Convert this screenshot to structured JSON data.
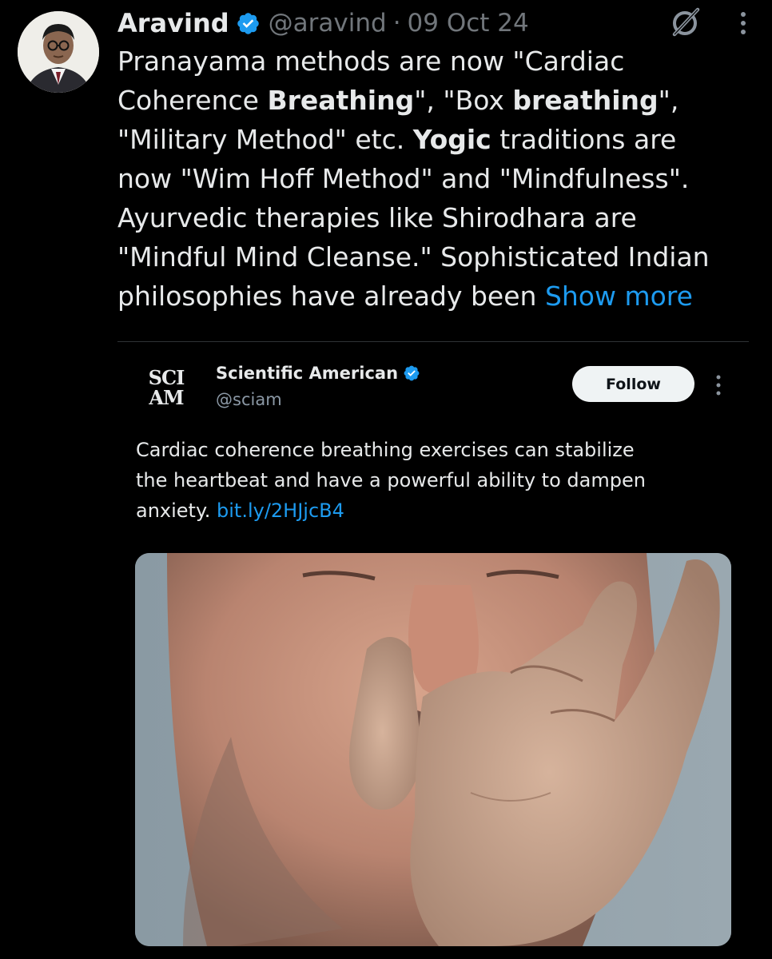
{
  "tweet": {
    "author_name": "Aravind",
    "handle": "@aravind",
    "separator": "·",
    "date": "09 Oct 24",
    "text_lines": [
      [
        "Pranayama methods are now \"Cardiac"
      ],
      [
        "Coherence ",
        "Breathing",
        "\", \"Box ",
        "breathing",
        "\","
      ],
      [
        "\"Military Method\" etc. ",
        "Yogic",
        " traditions are"
      ],
      [
        "now \"Wim Hoff Method\" and \"Mindfulness\"."
      ],
      [
        "Ayurvedic therapies like Shirodhara are"
      ],
      [
        "\"Mindful Mind Cleanse.\" Sophisticated Indian"
      ],
      [
        "philosophies have already been "
      ]
    ],
    "show_more_label": "Show more",
    "icons": [
      "verified-badge-icon",
      "grok-icon",
      "more-options-icon"
    ]
  },
  "quoted_tweet": {
    "logo_lines": [
      "SCI",
      "AM"
    ],
    "author_name": "Scientific American",
    "handle": "@sciam",
    "follow_label": "Follow",
    "text_lines": [
      "Cardiac coherence breathing exercises can stabilize",
      "the heartbeat and have a powerful ability to dampen",
      "anxiety. "
    ],
    "link_text": "bit.ly/2HJjcB4",
    "image_subject": "man performing alternate nostril breathing",
    "icons": [
      "verified-badge-icon",
      "more-options-icon"
    ]
  },
  "colors": {
    "background": "#000000",
    "text": "#e7e9ea",
    "secondary_text": "#71767b",
    "link": "#1d9bf0",
    "verified": "#1d9bf0",
    "follow_button_bg": "#eff3f4"
  }
}
